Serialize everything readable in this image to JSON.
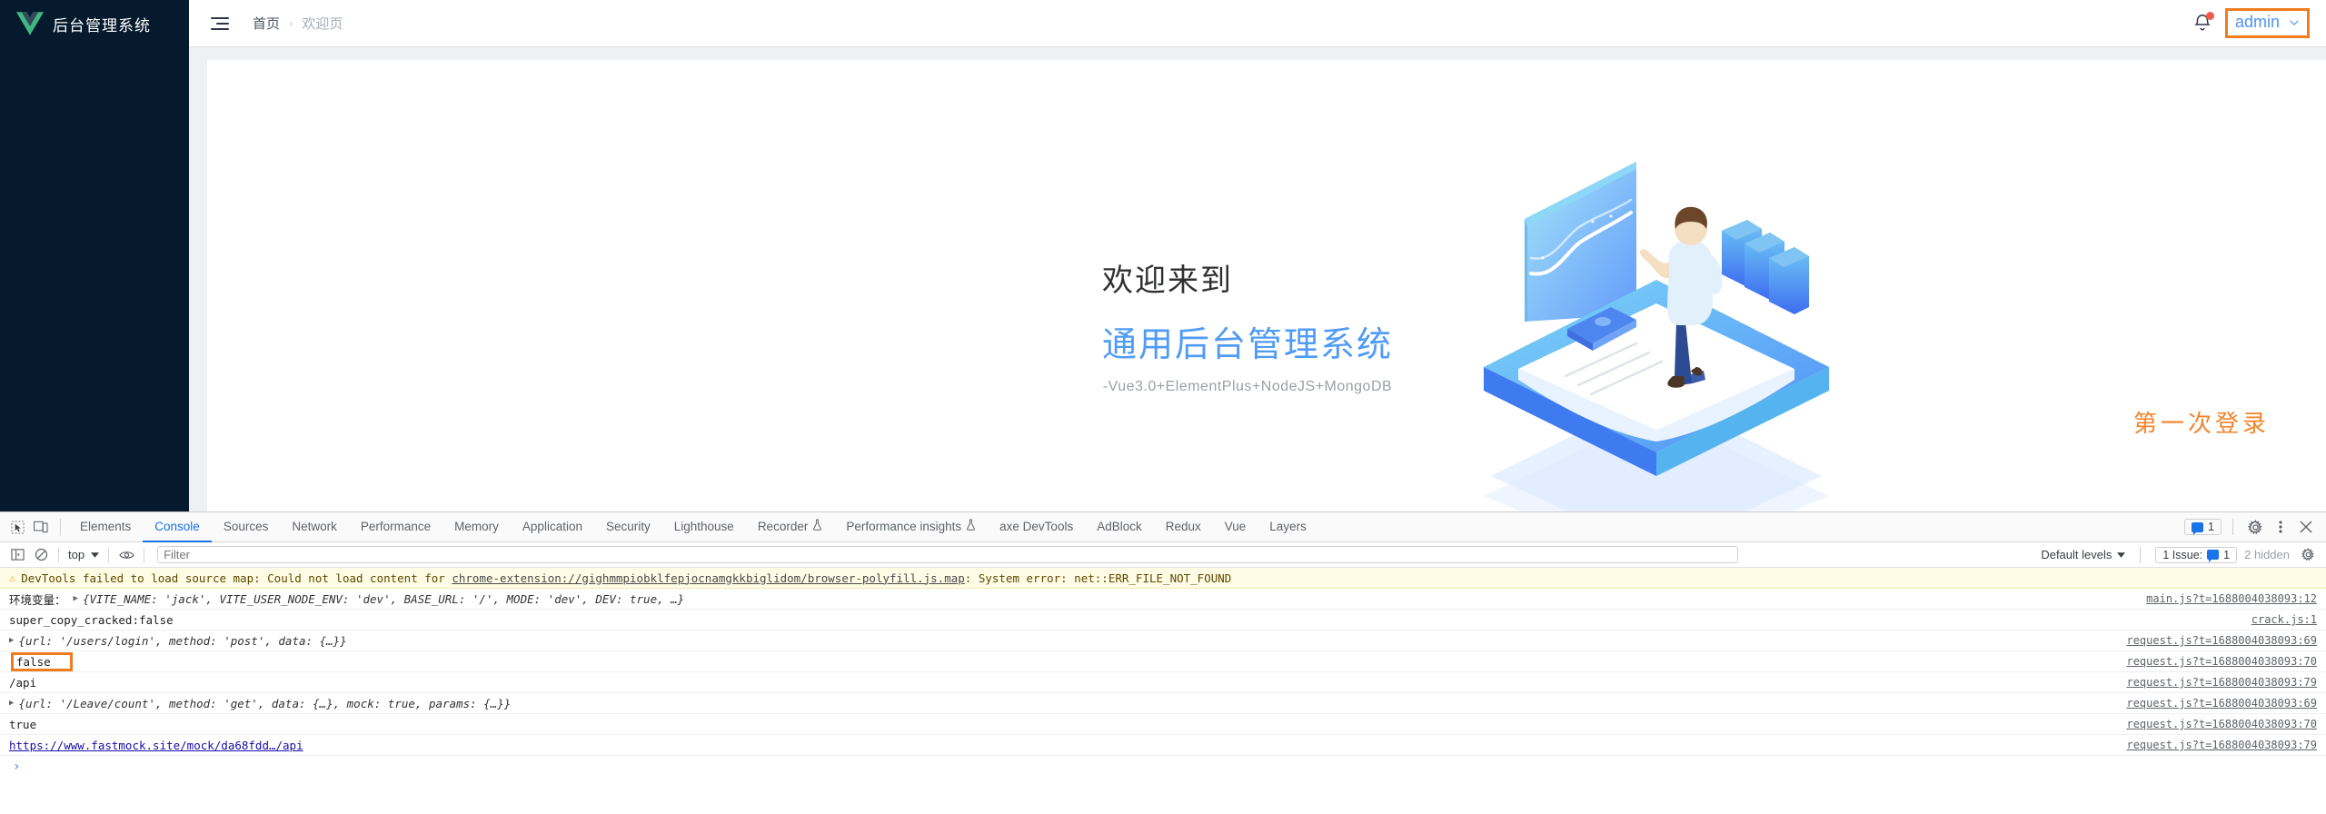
{
  "app": {
    "sidebar": {
      "logo_text": "后台管理系统",
      "logo_icon": "vue-logo-icon"
    },
    "header": {
      "menu_icon": "hamburger-fold-icon",
      "breadcrumb": {
        "home": "首页",
        "separator": "›",
        "current": "欢迎页"
      },
      "bell_icon": "notification-bell-icon",
      "user_name": "admin",
      "caret_icon": "chevron-down-icon"
    },
    "welcome": {
      "line1": "欢迎来到",
      "line2": "通用后台管理系统",
      "subtitle": "-Vue3.0+ElementPlus+NodeJS+MongoDB"
    },
    "annotation": {
      "first_login": "第一次登录"
    },
    "colors": {
      "sidebar_bg": "#061a2e",
      "brand_blue": "#4f9bf5",
      "highlight_orange": "#f07c1e",
      "user_blue": "#4f93f0"
    }
  },
  "devtools": {
    "tabs": [
      {
        "label": "Elements",
        "active": false,
        "flask": false
      },
      {
        "label": "Console",
        "active": true,
        "flask": false
      },
      {
        "label": "Sources",
        "active": false,
        "flask": false
      },
      {
        "label": "Network",
        "active": false,
        "flask": false
      },
      {
        "label": "Performance",
        "active": false,
        "flask": false
      },
      {
        "label": "Memory",
        "active": false,
        "flask": false
      },
      {
        "label": "Application",
        "active": false,
        "flask": false
      },
      {
        "label": "Security",
        "active": false,
        "flask": false
      },
      {
        "label": "Lighthouse",
        "active": false,
        "flask": false
      },
      {
        "label": "Recorder",
        "active": false,
        "flask": true
      },
      {
        "label": "Performance insights",
        "active": false,
        "flask": true
      },
      {
        "label": "axe DevTools",
        "active": false,
        "flask": false
      },
      {
        "label": "AdBlock",
        "active": false,
        "flask": false
      },
      {
        "label": "Redux",
        "active": false,
        "flask": false
      },
      {
        "label": "Vue",
        "active": false,
        "flask": false
      },
      {
        "label": "Layers",
        "active": false,
        "flask": false
      }
    ],
    "toolbar": {
      "inspect_icon": "inspect-element-icon",
      "device_icon": "device-toolbar-icon",
      "issues_count": "1",
      "settings_icon": "gear-icon",
      "more_icon": "more-vertical-icon",
      "close_icon": "close-icon"
    },
    "filterbar": {
      "sidebar_icon": "console-sidebar-icon",
      "clear_icon": "clear-console-icon",
      "context": "top",
      "context_caret": "chevron-down-icon",
      "eye_icon": "live-expression-icon",
      "filter_placeholder": "Filter",
      "filter_value": "",
      "levels": "Default levels",
      "levels_caret": "chevron-down-icon",
      "issues_label": "1 Issue:",
      "issues_count": "1",
      "hidden_label": "2 hidden",
      "settings_icon": "console-settings-icon"
    },
    "console_rows": [
      {
        "kind": "warning",
        "icon": "warning-triangle-icon",
        "text_before": "DevTools failed to load source map: Could not load content for ",
        "link": "chrome-extension://gighmmpiobklfepjocnamgkkbiglidom/browser-polyfill.js.map",
        "text_after": ": System error: net::ERR_FILE_NOT_FOUND",
        "source": ""
      },
      {
        "kind": "log-object",
        "label": "环境变量：",
        "expander": "▶",
        "object": "{VITE_NAME: 'jack', VITE_USER_NODE_ENV: 'dev', BASE_URL: '/', MODE: 'dev', DEV: true, …}",
        "source": "main.js?t=1688004038093:12"
      },
      {
        "kind": "log-text",
        "text": "super_copy_cracked:false",
        "source": "crack.js:1"
      },
      {
        "kind": "log-object",
        "expander": "▶",
        "object": "{url: '/users/login', method: 'post', data: {…}}",
        "source": "request.js?t=1688004038093:69"
      },
      {
        "kind": "log-boxed",
        "text": "false",
        "source": "request.js?t=1688004038093:70"
      },
      {
        "kind": "log-text",
        "text": "/api",
        "source": "request.js?t=1688004038093:79"
      },
      {
        "kind": "log-object",
        "expander": "▶",
        "object": "{url: '/Leave/count', method: 'get', data: {…}, mock: true, params: {…}}",
        "source": "request.js?t=1688004038093:69"
      },
      {
        "kind": "log-text",
        "text": "true",
        "source": "request.js?t=1688004038093:70"
      },
      {
        "kind": "log-link",
        "text": "https://www.fastmock.site/mock/da68fdd…/api",
        "source": "request.js?t=1688004038093:79"
      },
      {
        "kind": "prompt",
        "text": "›",
        "source": ""
      }
    ]
  }
}
